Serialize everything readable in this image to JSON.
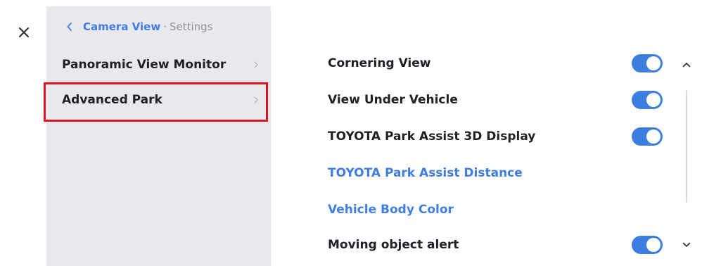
{
  "window": {
    "close_icon": "close-icon"
  },
  "breadcrumb": {
    "back_icon": "chevron-left-icon",
    "parent": "Camera View",
    "separator": "·",
    "current": "Settings"
  },
  "sidebar": {
    "items": [
      {
        "label": "Panoramic View Monitor",
        "icon": "chevron-right-icon",
        "selected": false
      },
      {
        "label": "Advanced Park",
        "icon": "chevron-right-icon",
        "selected": true
      }
    ]
  },
  "settings": {
    "items": [
      {
        "label": "Cornering View",
        "type": "toggle",
        "on": true
      },
      {
        "label": "View Under Vehicle",
        "type": "toggle",
        "on": true
      },
      {
        "label": "TOYOTA Park Assist 3D Display",
        "type": "toggle",
        "on": true
      },
      {
        "label": "TOYOTA Park Assist Distance",
        "type": "link"
      },
      {
        "label": "Vehicle Body Color",
        "type": "link"
      },
      {
        "label": "Moving object alert",
        "type": "toggle",
        "on": true
      }
    ]
  },
  "scroll": {
    "up_icon": "chevron-up-icon",
    "down_icon": "chevron-down-icon"
  },
  "colors": {
    "accent": "#3f7de3",
    "toggle_on": "#3b7ee0",
    "sidebar_bg": "#e9e9ed",
    "highlight": "#e3131b",
    "text": "#1f2127",
    "muted": "#8f949c"
  }
}
